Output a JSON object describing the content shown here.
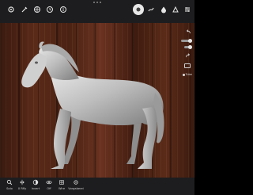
{
  "toolbar": {
    "top_left_icons": [
      "gear-icon",
      "tools-icon",
      "grid-icon",
      "history-icon",
      "info-icon"
    ],
    "top_right_icons": [
      "sculpt-brush-icon",
      "stroke-icon",
      "material-icon",
      "curve-icon",
      "tool-settings-icon"
    ]
  },
  "right_panel": {
    "icons": [
      "undo-icon",
      "redo-icon",
      "cube-icon"
    ],
    "label": "Tube"
  },
  "bottom_bar": {
    "items": [
      {
        "label": "Solo",
        "icon": "search-icon"
      },
      {
        "label": "X Rfly",
        "icon": "mirror-icon"
      },
      {
        "label": "Invert",
        "icon": "invert-icon"
      },
      {
        "label": "Off",
        "icon": "eye-icon"
      },
      {
        "label": "Wire",
        "icon": "wire-icon"
      },
      {
        "label": "Vorgaberei",
        "icon": "settings-icon"
      }
    ]
  },
  "colors": {
    "toolbar_bg": "#1d1d1f",
    "wood_dark": "#3a1a10",
    "wood_light": "#6a3220",
    "model": "#b9b9b9"
  }
}
